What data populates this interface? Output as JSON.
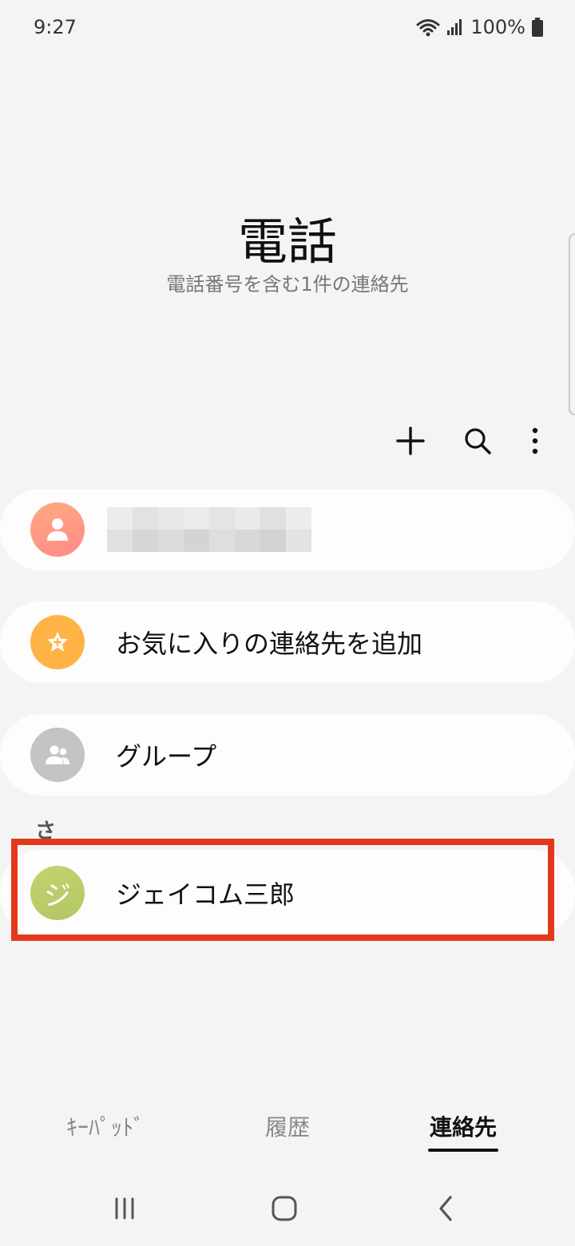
{
  "status_bar": {
    "time": "9:27",
    "battery": "100%"
  },
  "header": {
    "title": "電話",
    "subtitle": "電話番号を含む1件の連絡先"
  },
  "toolbar": {
    "icons": [
      "plus-icon",
      "search-icon",
      "more-options-icon"
    ]
  },
  "profile_card": {
    "icon": "person-icon",
    "avatar_color": "#ff9784"
  },
  "favorites_card": {
    "label": "お気に入りの連絡先を追加",
    "icon": "star-icon",
    "avatar_color": "#ffb347"
  },
  "groups_card": {
    "label": "グループ",
    "icon": "people-icon",
    "avatar_color": "#c4c4c4"
  },
  "section_index": "さ",
  "contact": {
    "initial": "ジ",
    "name": "ジェイコム三郎",
    "avatar_color": "#bccc6a"
  },
  "tabs": {
    "keypad": "ｷｰﾊﾟｯﾄﾞ",
    "history": "履歴",
    "contacts": "連絡先"
  },
  "highlight_color": "#e2391c",
  "nav_icons": [
    "recents-icon",
    "home-icon",
    "back-icon"
  ]
}
